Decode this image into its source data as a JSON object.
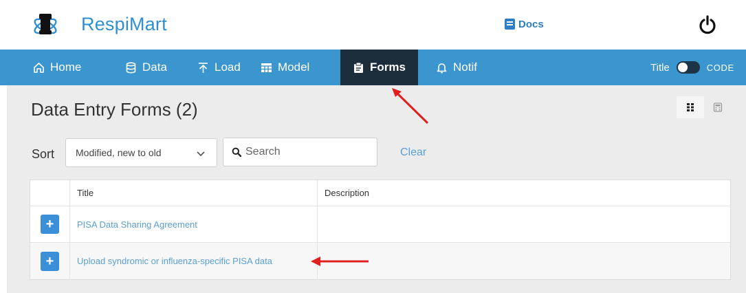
{
  "app": {
    "brand": "RespiMart",
    "docs_label": "Docs"
  },
  "nav": {
    "items": [
      {
        "label": "Home",
        "icon": "home-icon"
      },
      {
        "label": "Data",
        "icon": "database-icon"
      },
      {
        "label": "Load",
        "icon": "upload-icon"
      },
      {
        "label": "Model",
        "icon": "table-icon"
      },
      {
        "label": "Forms",
        "icon": "clipboard-icon",
        "active": true
      },
      {
        "label": "Notif",
        "icon": "bell-icon"
      }
    ],
    "toggle": {
      "left_label": "Title",
      "right_label": "CODE"
    }
  },
  "page": {
    "title": "Data Entry Forms (2)"
  },
  "toolbar": {
    "sort_label": "Sort",
    "sort_value": "Modified, new to old",
    "search_placeholder": "Search",
    "clear_label": "Clear"
  },
  "table": {
    "columns": [
      "Title",
      "Description"
    ],
    "rows": [
      {
        "title": "PISA Data Sharing Agreement",
        "description": ""
      },
      {
        "title": "Upload syndromic or influenza-specific PISA data",
        "description": ""
      }
    ],
    "add_label": "+"
  },
  "colors": {
    "brand": "#2f8fd0",
    "navbar": "#3b95cf",
    "nav_active": "#1c2d3c",
    "add_button": "#3a8fd8",
    "link": "#5a9fd4",
    "annotation": "#e0201d"
  }
}
